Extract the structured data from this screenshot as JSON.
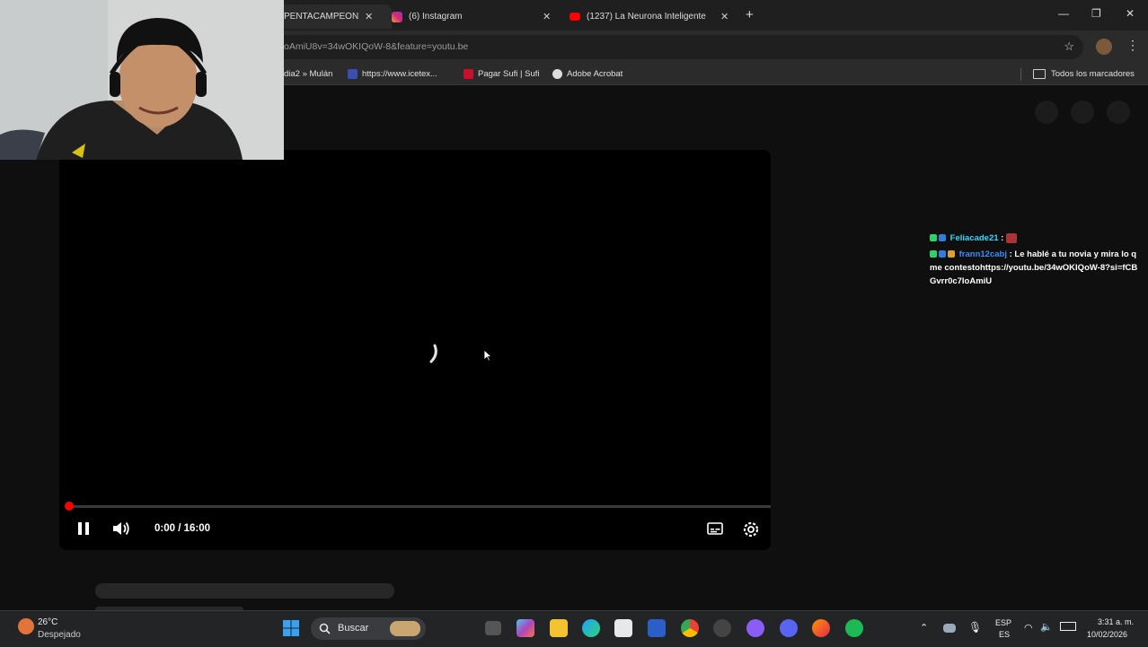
{
  "tabs": [
    {
      "title": "PENTACAMPEÓN",
      "active": true
    },
    {
      "title": "(6) Instagram",
      "active": false
    },
    {
      "title": "(1237) La Neurona Inteligente",
      "active": false
    }
  ],
  "address_bar": {
    "url": "oAmiU8v=34wOKIQoW-8&feature=youtu.be"
  },
  "bookmarks": [
    {
      "label": "dia2 » Mulán"
    },
    {
      "label": "https://www.icetex..."
    },
    {
      "label": "Pagar Sufi | Sufi"
    },
    {
      "label": "Adobe Acrobat"
    },
    {
      "label": "Todos los marcadores"
    }
  ],
  "player": {
    "time": "0:00 / 16:00",
    "progress_fraction": 0.0
  },
  "chat": {
    "messages": [
      {
        "user": "Feliacade21",
        "text": ""
      },
      {
        "user": "frann12cabj",
        "text": "Le hablé a tu novia y mira lo q me contestohttps://youtu.be/34wOKIQoW-8?si=fCBGvrr0c7IoAmiU"
      }
    ]
  },
  "taskbar": {
    "weather_temp": "26°C",
    "weather_desc": "Despejado",
    "search_label": "Buscar",
    "lang_top": "ESP",
    "lang_bottom": "ES",
    "clock_time": "3:31 a. m.",
    "clock_date": "10/02/2026"
  },
  "colors": {
    "progress": "#ff0000",
    "youtube_red": "#ff0000",
    "chat_user1": "#32d7ff",
    "chat_user2": "#3b8cff"
  }
}
